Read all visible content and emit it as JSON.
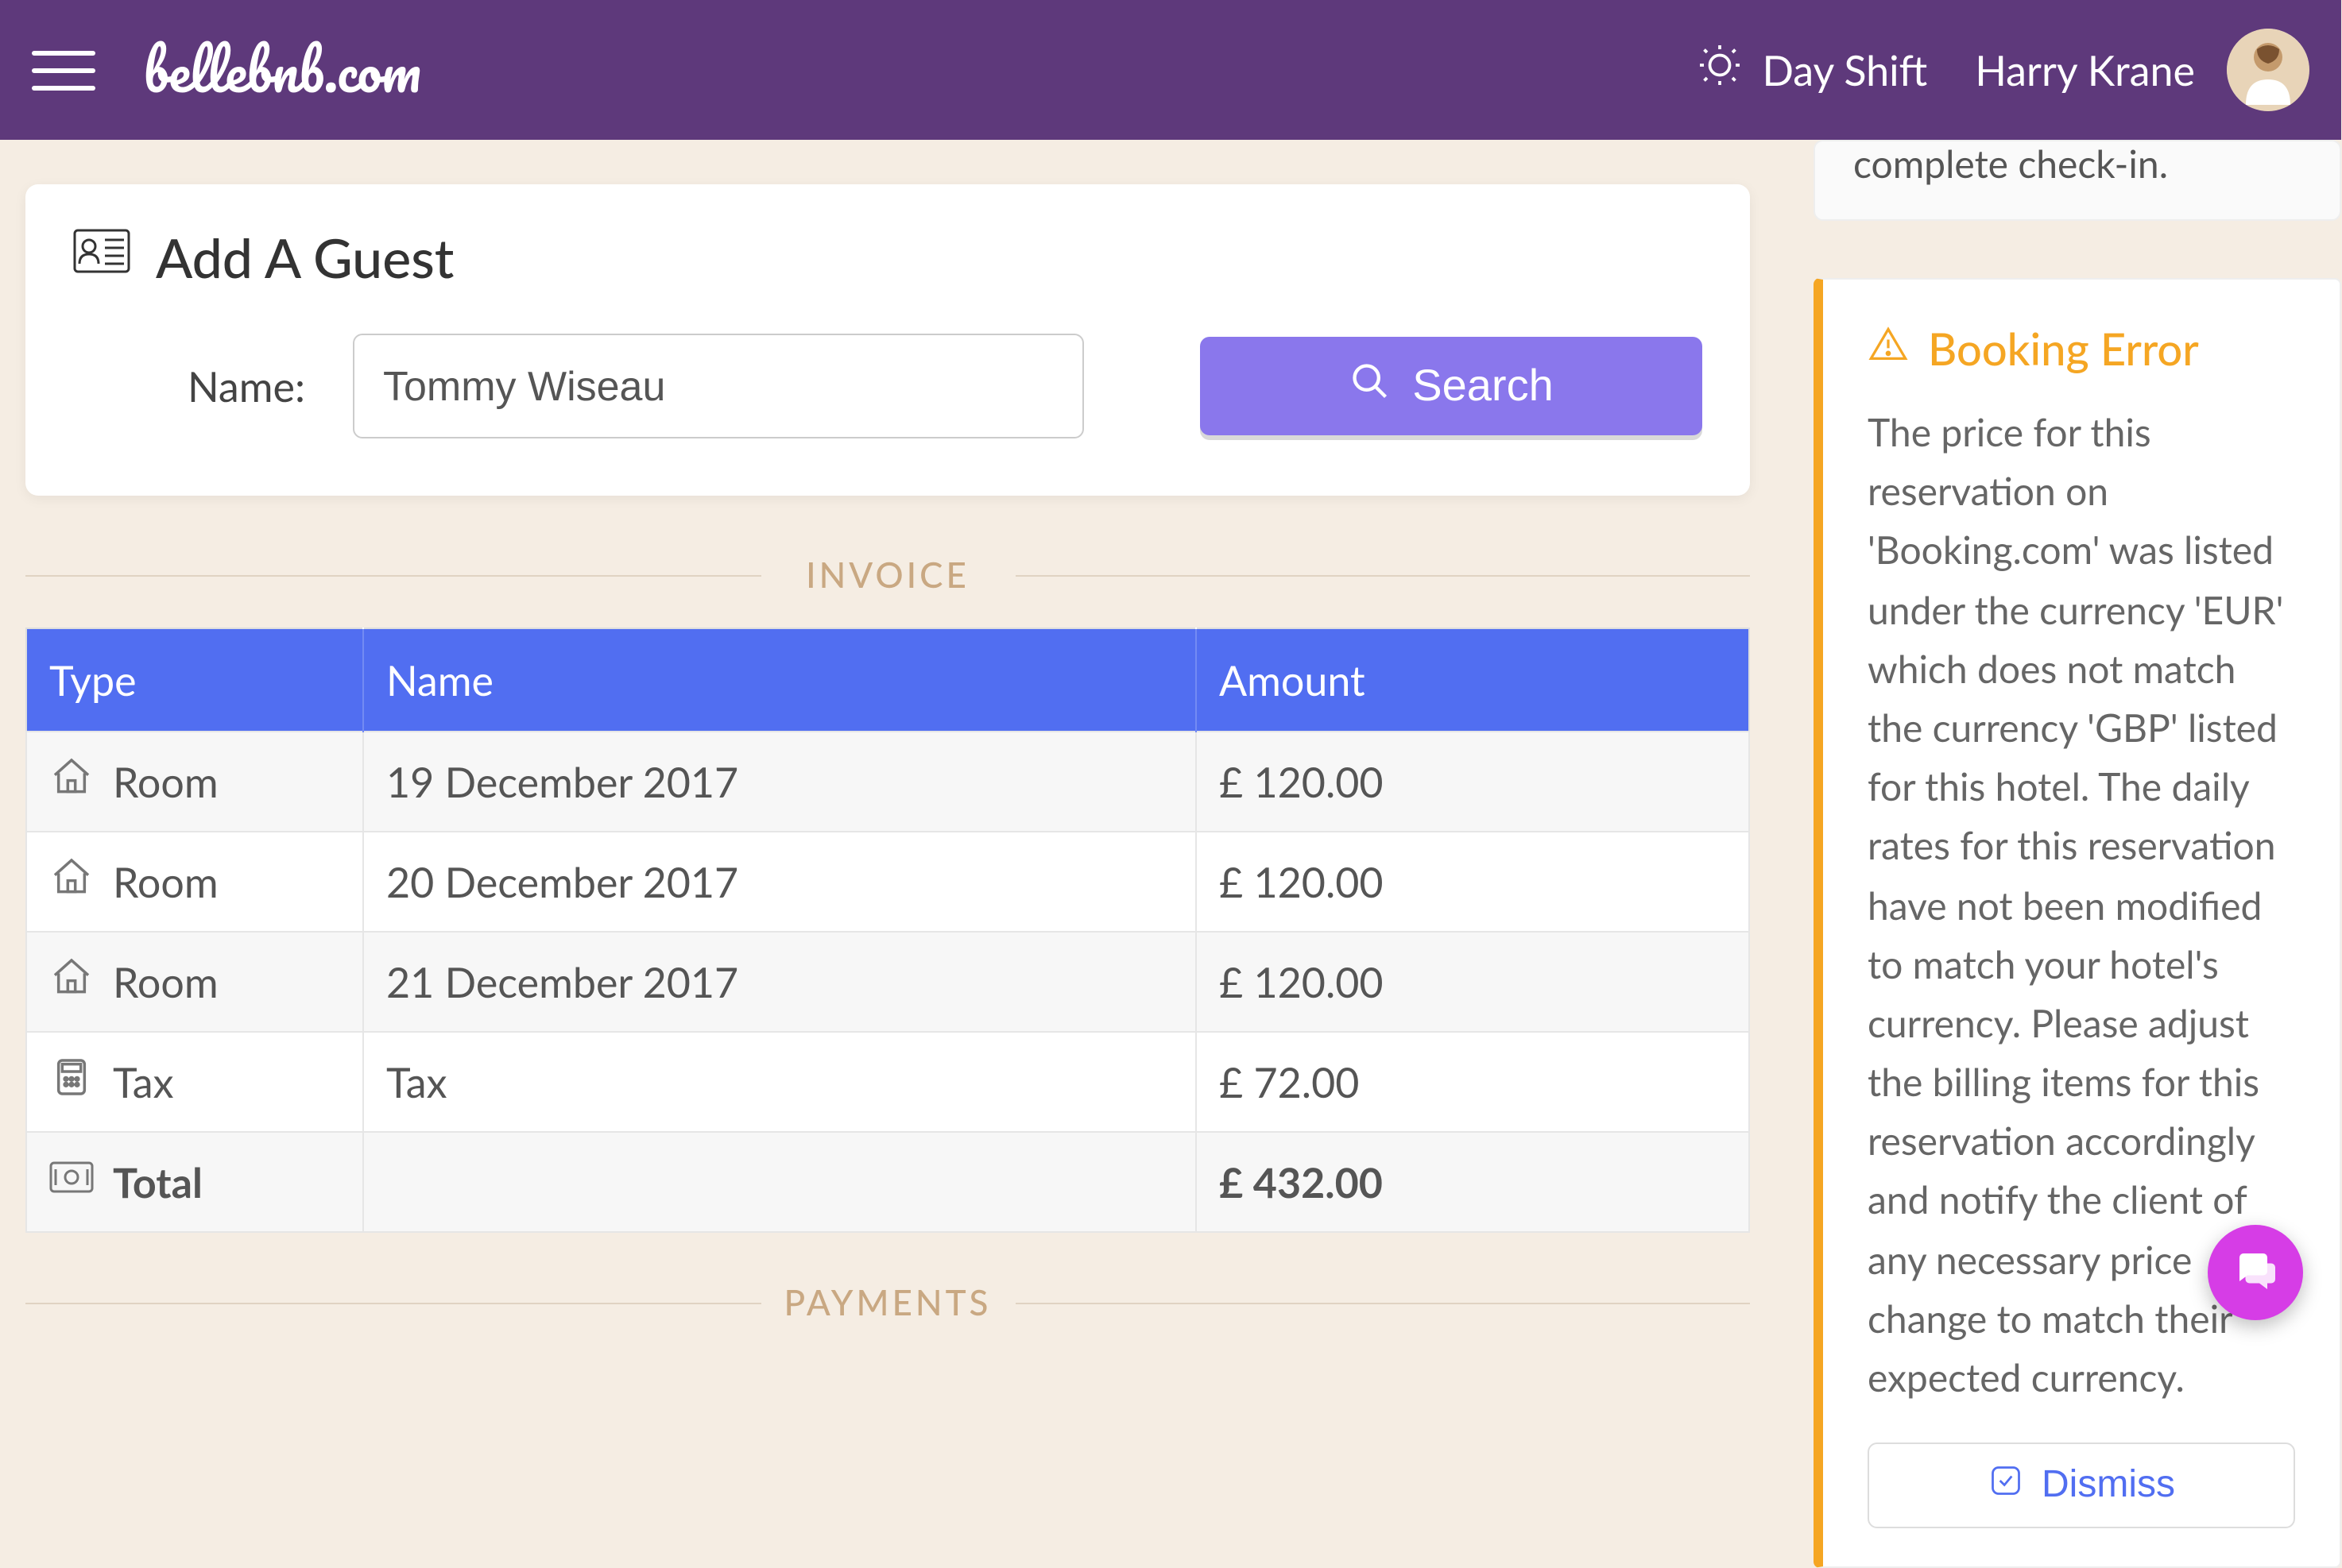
{
  "header": {
    "brand": "bellebnb.com",
    "shift_label": "Day Shift",
    "user_name": "Harry Krane"
  },
  "add_guest": {
    "title": "Add A Guest",
    "name_label": "Name:",
    "name_value": "Tommy Wiseau",
    "search_label": "Search"
  },
  "sections": {
    "invoice": "INVOICE",
    "payments": "PAYMENTS"
  },
  "invoice": {
    "columns": {
      "type": "Type",
      "name": "Name",
      "amount": "Amount"
    },
    "rows": [
      {
        "type": "Room",
        "name": "19 December 2017",
        "amount": "£ 120.00",
        "icon": "home"
      },
      {
        "type": "Room",
        "name": "20 December 2017",
        "amount": "£ 120.00",
        "icon": "home"
      },
      {
        "type": "Room",
        "name": "21 December 2017",
        "amount": "£ 120.00",
        "icon": "home"
      },
      {
        "type": "Tax",
        "name": "Tax",
        "amount": "£ 72.00",
        "icon": "calc"
      }
    ],
    "total": {
      "label": "Total",
      "amount": "£ 432.00",
      "icon": "money"
    }
  },
  "notice": {
    "snippet": "complete check-in."
  },
  "alert": {
    "title": "Booking Error",
    "body": "The price for this reservation on 'Booking.com' was listed under the currency 'EUR' which does not match the currency 'GBP' listed for this hotel. The daily rates for this reservation have not been modified to match your hotel's currency. Please adjust the billing items for this reservation accordingly and notify the client of any necessary price change to match their expected currency.",
    "dismiss": "Dismiss"
  }
}
